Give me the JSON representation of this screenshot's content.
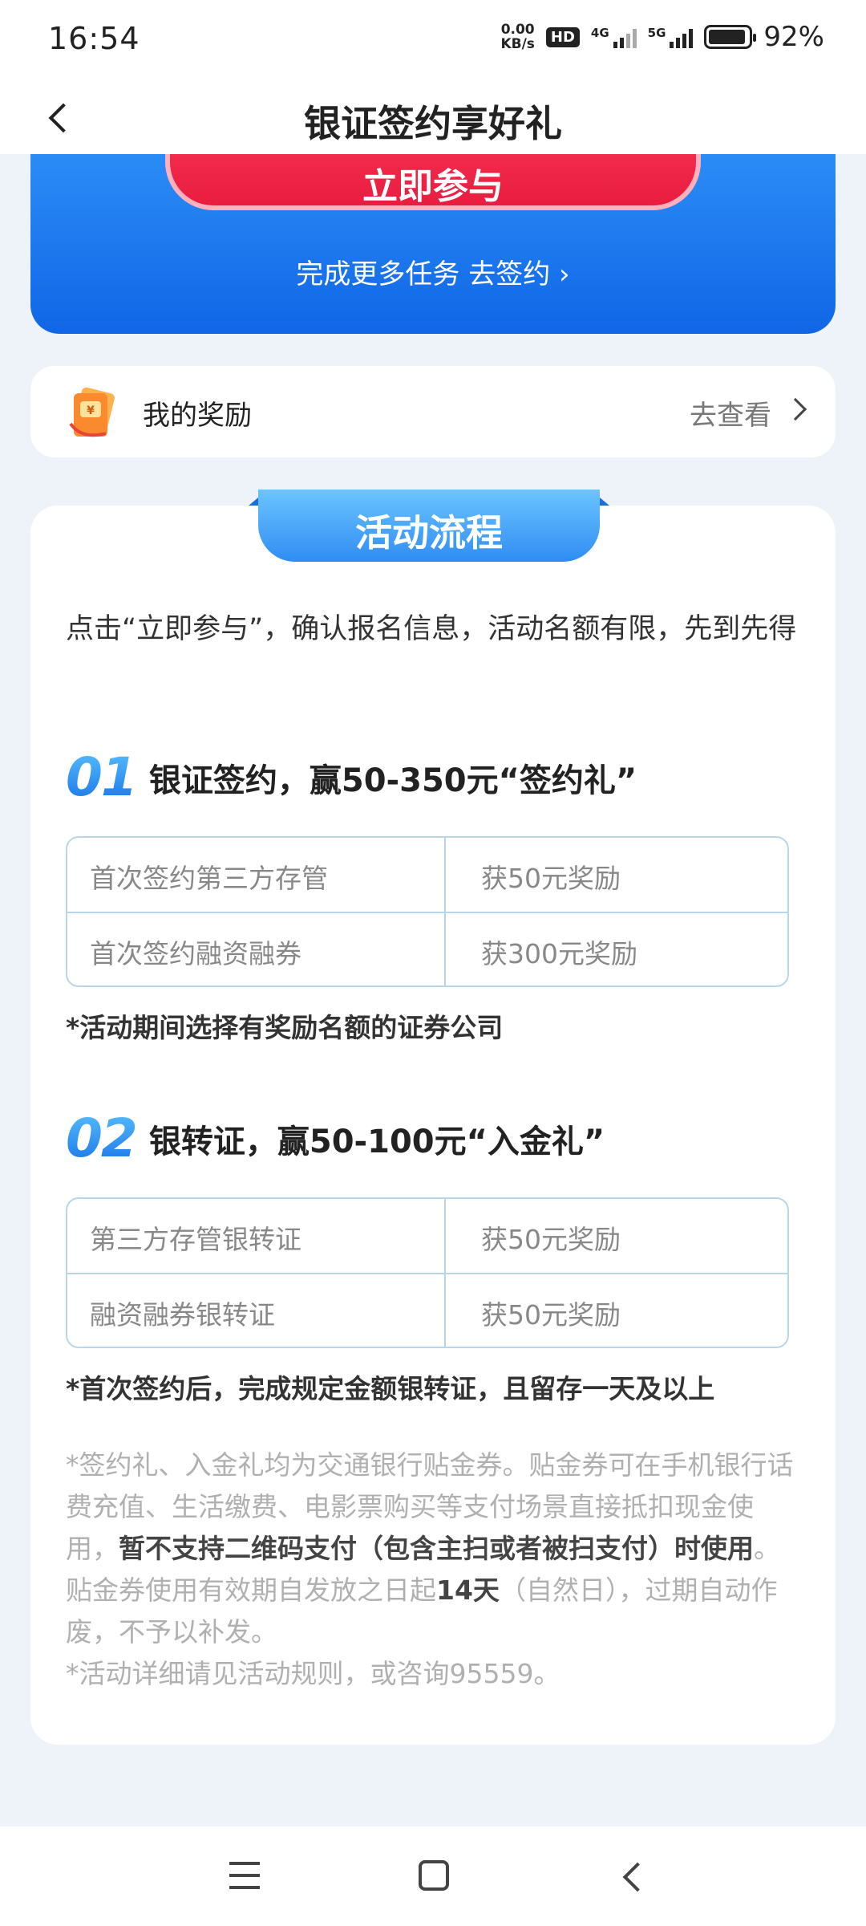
{
  "status_bar": {
    "time": "16:54",
    "net_speed_value": "0.00",
    "net_speed_unit": "KB/s",
    "hd_badge": "HD",
    "signal1_label": "4G",
    "signal2_label": "5G",
    "battery_percent": "92%",
    "battery_level": 0.92
  },
  "nav": {
    "title": "银证签约享好礼"
  },
  "banner": {
    "join_label": "立即参与",
    "more_tasks": "完成更多任务 去签约 ›"
  },
  "rewards": {
    "label": "我的奖励",
    "view": "去查看"
  },
  "process": {
    "tab_title": "活动流程",
    "intro": "点击“立即参与”，确认报名信息，活动名额有限，先到先得",
    "step1": {
      "num": "01",
      "title": "银证签约，赢50-350元“签约礼”",
      "rows": [
        {
          "item": "首次签约第三方存管",
          "reward": "获50元奖励"
        },
        {
          "item": "首次签约融资融券",
          "reward": "获300元奖励"
        }
      ],
      "note": "*活动期间选择有奖励名额的证券公司"
    },
    "step2": {
      "num": "02",
      "title": "银转证，赢50-100元“入金礼”",
      "rows": [
        {
          "item": "第三方存管银转证",
          "reward": "获50元奖励"
        },
        {
          "item": "融资融券银转证",
          "reward": "获50元奖励"
        }
      ],
      "note": "*首次签约后，完成规定金额银转证，且留存一天及以上"
    },
    "fine_print": {
      "p1_a": "*签约礼、入金礼均为交通银行贴金券。贴金券可在手机银行话费充值、生活缴费、电影票购买等支付场景直接抵扣现金使用，",
      "p1_b": "暂不支持二维码支付（包含主扫或者被扫支付）时使用",
      "p1_c": "。贴金券使用有效期自发放之日起",
      "p1_d": "14天",
      "p1_e": "（自然日），过期自动作废，不予以补发。",
      "p2": "*活动详细请见活动规则，或咨询95559。"
    }
  },
  "colors": {
    "banner_blue": "#1066e6",
    "join_red": "#f2294a",
    "tab_blue": "#2f8df3",
    "step_num_blue": "#1a8ef5",
    "page_bg": "#eef3fa"
  },
  "icons": {
    "back": "chevron-left-icon",
    "reward": "gift-voucher-icon",
    "chevron": "chevron-right-icon",
    "menu": "menu-icon",
    "home": "home-square-icon",
    "sys_back": "back-arrow-icon"
  }
}
